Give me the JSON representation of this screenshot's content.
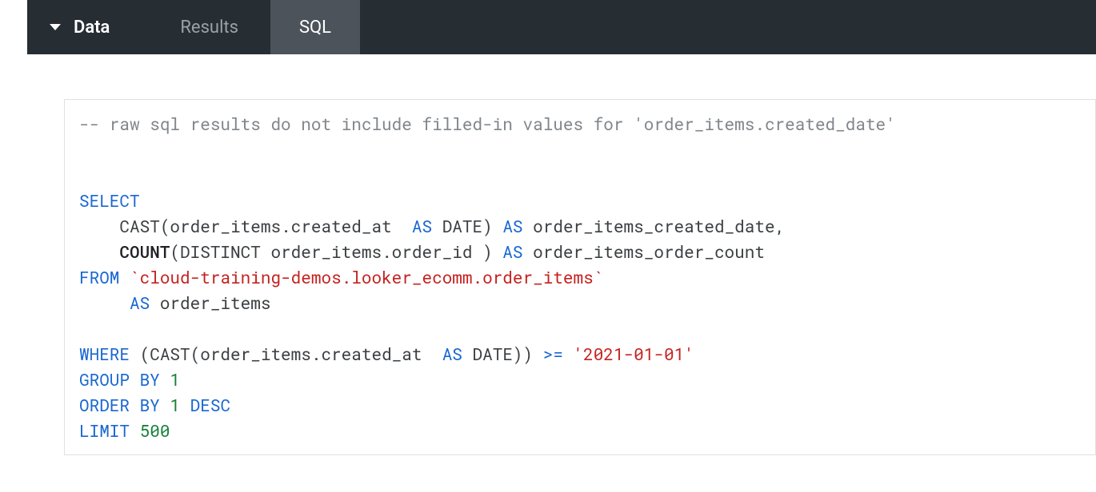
{
  "tabs": {
    "data": "Data",
    "results": "Results",
    "sql": "SQL"
  },
  "sql": {
    "comment": "-- raw sql results do not include filled-in values for 'order_items.created_date'",
    "select": "SELECT",
    "cast1a": "    CAST(order_items.created_at  ",
    "as1": "AS",
    "date1": " DATE) ",
    "as2": "AS",
    "alias1": " order_items_created_date,",
    "count": "    COUNT",
    "distinct": "(DISTINCT order_items.order_id ) ",
    "as3": "AS",
    "alias2": " order_items_order_count",
    "from": "FROM",
    "table": " `cloud-training-demos.looker_ecomm.order_items`",
    "as4": "     AS",
    "tablealias": " order_items",
    "where": "WHERE",
    "cast2": " (CAST(order_items.created_at  ",
    "as5": "AS",
    "date2": " DATE)) ",
    "op": ">=",
    "datestr": " '2021-01-01'",
    "groupby": "GROUP BY",
    "g1": " 1",
    "orderby": "ORDER BY",
    "o1": " 1 ",
    "desc": "DESC",
    "limit": "LIMIT",
    "limnum": " 500"
  }
}
